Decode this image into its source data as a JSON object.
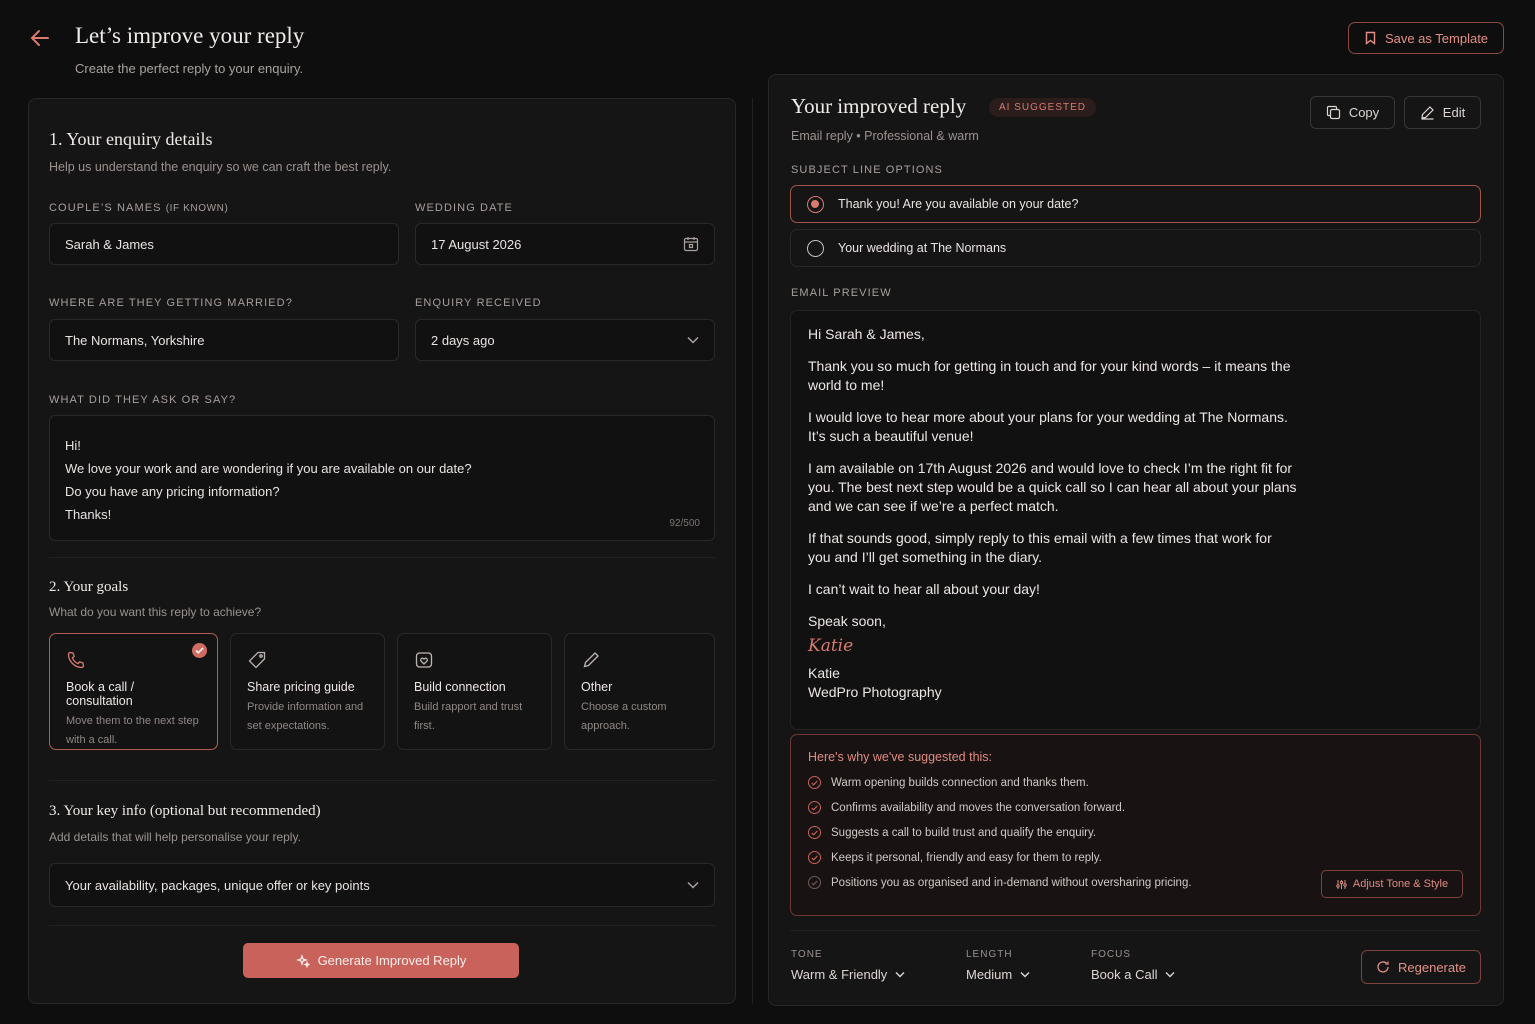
{
  "header": {
    "title": "Let’s improve your reply",
    "subtitle": "Create the perfect reply to your enquiry.",
    "save_template_label": "Save as Template"
  },
  "enquiry": {
    "heading": "1. Your enquiry details",
    "description": "Help us understand the enquiry so we can craft the best reply.",
    "couple_label": "COUPLE’S NAMES",
    "couple_label_suffix": "(IF KNOWN)",
    "couple_value": "Sarah & James",
    "date_label": "WEDDING DATE",
    "date_value": "17 August 2026",
    "venue_label": "WHERE ARE THEY GETTING MARRIED?",
    "venue_value": "The Normans, Yorkshire",
    "received_label": "ENQUIRY RECEIVED",
    "received_value": "2 days ago",
    "message_label": "WHAT DID THEY ASK OR SAY?",
    "message_lines": [
      "Hi!",
      "We love your work and are wondering if you are available on our date?",
      "Do you have any pricing information?",
      "Thanks!"
    ],
    "char_count": "92/500"
  },
  "goals": {
    "heading": "2. Your goals",
    "description": "What do you want this reply to achieve?",
    "items": [
      {
        "title": "Book a call / consultation",
        "desc": "Move them to the next step with a call.",
        "icon": "phone-icon",
        "selected": true
      },
      {
        "title": "Share pricing guide",
        "desc": "Provide information and set expectations.",
        "icon": "tag-icon",
        "selected": false
      },
      {
        "title": "Build connection",
        "desc": "Build rapport and trust first.",
        "icon": "heart-icon",
        "selected": false
      },
      {
        "title": "Other",
        "desc": "Choose a custom approach.",
        "icon": "pencil-icon",
        "selected": false
      }
    ]
  },
  "key_info": {
    "heading": "3. Your key info (optional but recommended)",
    "description": "Add details that will help personalise your reply.",
    "placeholder": "Your availability, packages, unique offer or key points"
  },
  "generate_label": "Generate Improved Reply",
  "reply": {
    "heading": "Your improved reply",
    "badge": "AI SUGGESTED",
    "meta": "Email reply • Professional & warm",
    "copy_label": "Copy",
    "edit_label": "Edit",
    "subject_label": "SUBJECT LINE OPTIONS",
    "subjects": [
      {
        "text": "Thank you! Are you available on your date?",
        "selected": true
      },
      {
        "text": "Your wedding at The Normans",
        "selected": false
      }
    ],
    "preview_label": "EMAIL PREVIEW",
    "email": {
      "greeting": "Hi Sarah & James,",
      "paragraphs": [
        "Thank you so much for getting in touch and for your kind words – it means the world to me!",
        "I would love to hear more about your plans for your wedding at The Normans. It’s such a beautiful venue!",
        "I am available on 17th August 2026 and would love to check I’m the right fit for you. The best next step would be a quick call so I can hear all about your plans and we can see if we’re a perfect match.",
        "If that sounds good, simply reply to this email with a few times that work for you and I’ll get something in the diary.",
        "I can’t wait to hear all about your day!"
      ],
      "signoff": "Speak soon,",
      "signature": "Katie",
      "name": "Katie",
      "company": "WedPro Photography"
    },
    "why_heading": "Here's why we've suggested this:",
    "why_items": [
      "Warm opening builds connection and thanks them.",
      "Confirms availability and moves the conversation forward.",
      "Suggests a call to build trust and qualify the enquiry.",
      "Keeps it personal, friendly and easy for them to reply.",
      "Positions you as organised and in-demand without oversharing pricing."
    ],
    "adjust_label": "Adjust Tone & Style",
    "tone_label": "TONE",
    "tone_value": "Warm & Friendly",
    "length_label": "LENGTH",
    "length_value": "Medium",
    "focus_label": "FOCUS",
    "focus_value": "Book a Call",
    "regenerate_label": "Regenerate"
  },
  "colors": {
    "accent": "#d97a70",
    "background": "#0f0e0e",
    "panel": "#161515",
    "button": "#c9625a"
  }
}
